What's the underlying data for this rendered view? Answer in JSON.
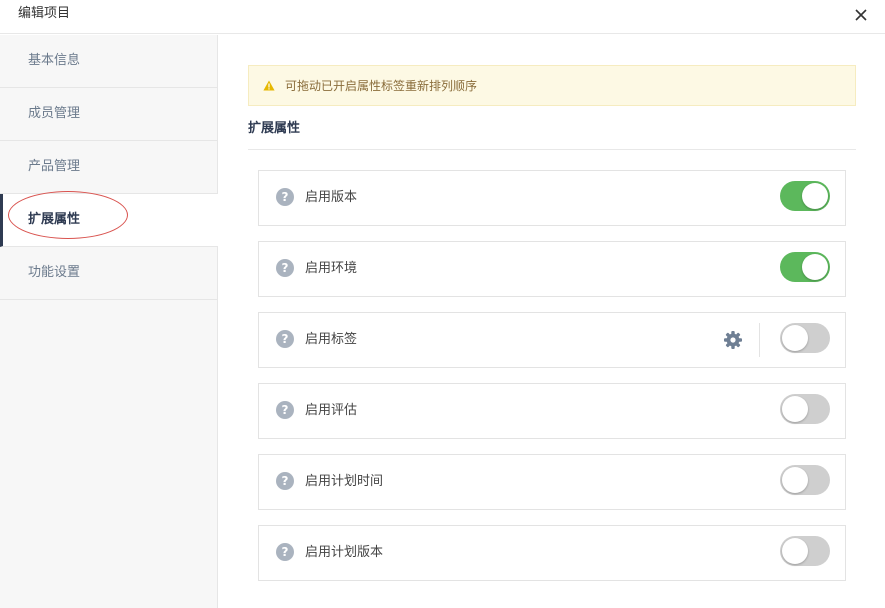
{
  "dialog": {
    "title": "编辑项目",
    "close_icon": "close-icon"
  },
  "sidebar": {
    "items": [
      {
        "label": "基本信息",
        "active": false
      },
      {
        "label": "成员管理",
        "active": false
      },
      {
        "label": "产品管理",
        "active": false
      },
      {
        "label": "扩展属性",
        "active": true
      },
      {
        "label": "功能设置",
        "active": false
      }
    ]
  },
  "notice": {
    "icon": "warning-icon",
    "text": "可拖动已开启属性标签重新排列顺序"
  },
  "section": {
    "title": "扩展属性"
  },
  "properties": [
    {
      "label": "启用版本",
      "enabled": true,
      "has_settings": false
    },
    {
      "label": "启用环境",
      "enabled": true,
      "has_settings": false
    },
    {
      "label": "启用标签",
      "enabled": false,
      "has_settings": true
    },
    {
      "label": "启用评估",
      "enabled": false,
      "has_settings": false
    },
    {
      "label": "启用计划时间",
      "enabled": false,
      "has_settings": false
    },
    {
      "label": "启用计划版本",
      "enabled": false,
      "has_settings": false
    }
  ],
  "help_glyph": "?",
  "colors": {
    "toggle_on": "#5cb85c",
    "toggle_off": "#cfcfcf",
    "active_nav": "#2f3b52",
    "notice_bg": "#fdf9e4",
    "annotation": "#d9534f"
  }
}
